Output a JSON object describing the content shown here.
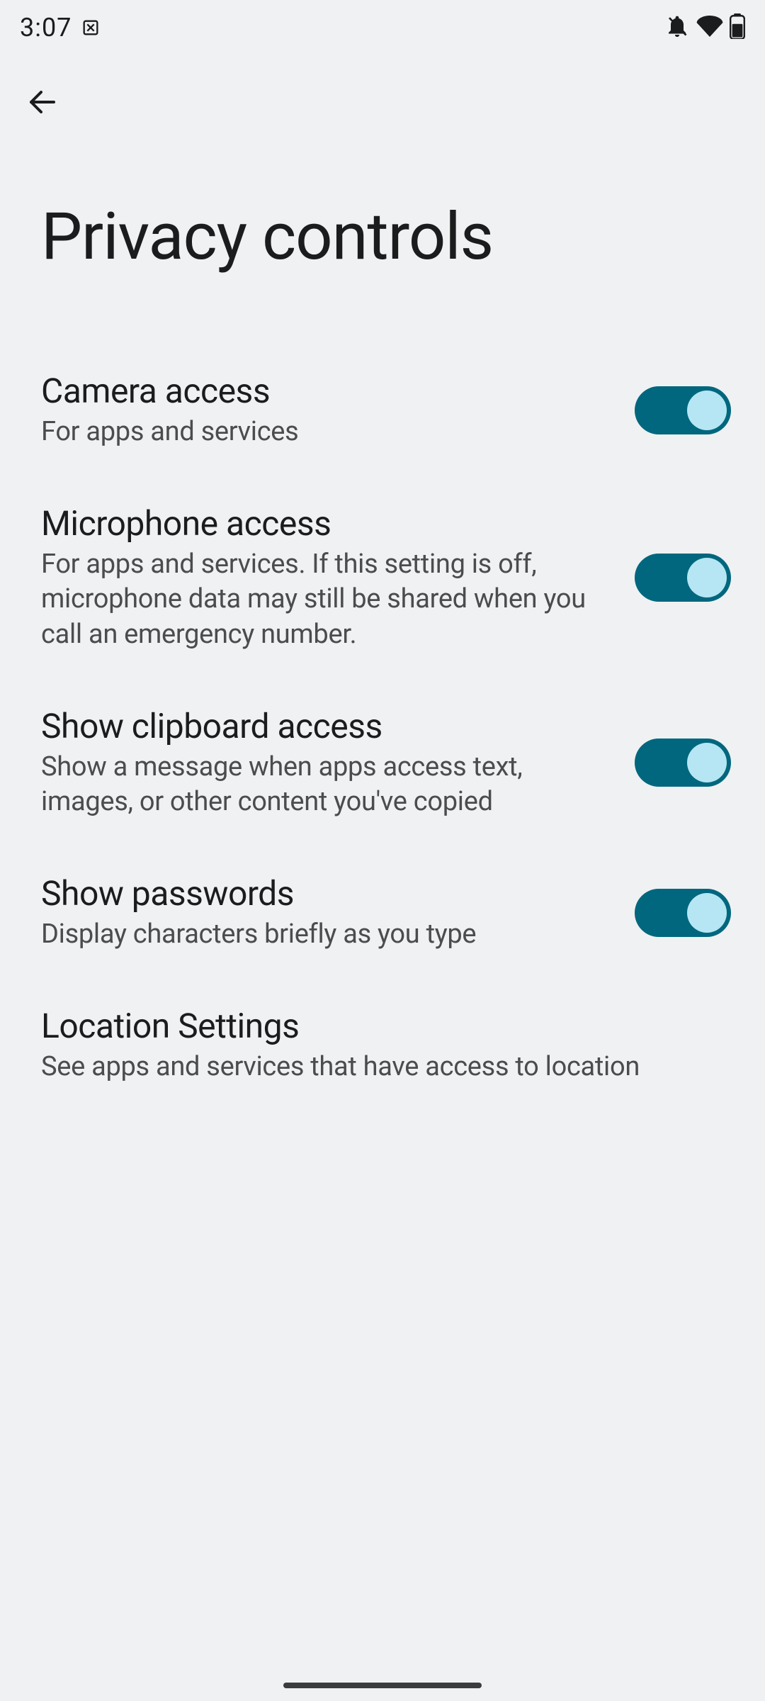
{
  "status_bar": {
    "time": "3:07"
  },
  "header": {
    "title": "Privacy controls"
  },
  "settings": [
    {
      "title": "Camera access",
      "description": "For apps and services",
      "toggle": true
    },
    {
      "title": "Microphone access",
      "description": "For apps and services. If this setting is off, microphone data may still be shared when you call an emergency number.",
      "toggle": true
    },
    {
      "title": "Show clipboard access",
      "description": "Show a message when apps access text, images, or other content you've copied",
      "toggle": true
    },
    {
      "title": "Show passwords",
      "description": "Display characters briefly as you type",
      "toggle": true
    },
    {
      "title": "Location Settings",
      "description": "See apps and services that have access to location",
      "toggle": false
    }
  ]
}
